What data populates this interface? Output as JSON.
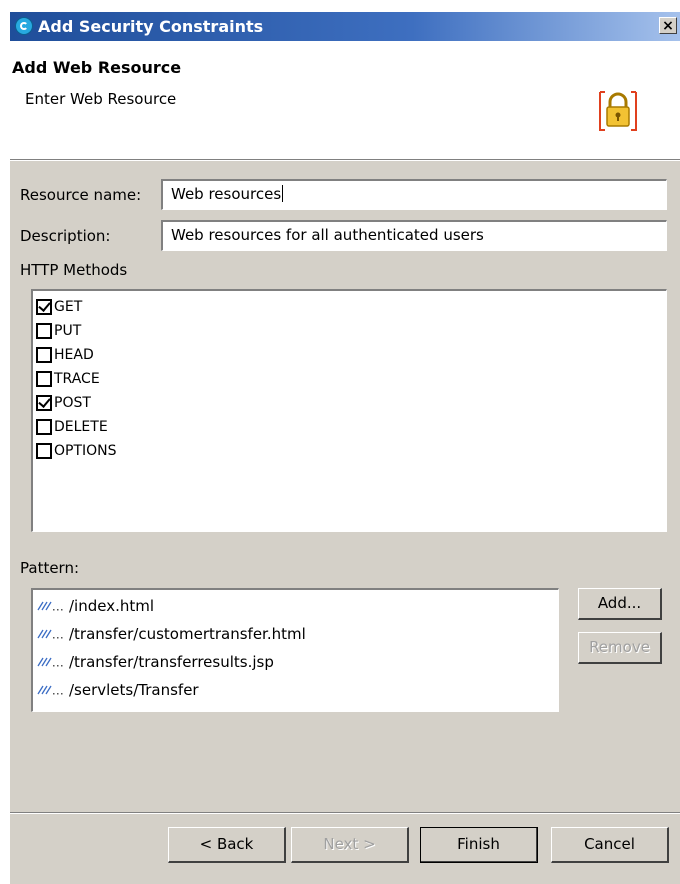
{
  "window": {
    "title": "Add Security Constraints",
    "close_label": "×"
  },
  "banner": {
    "title": "Add Web Resource",
    "description": "Enter Web Resource",
    "icon": "lock-icon"
  },
  "form": {
    "resource_name_label": "Resource name:",
    "resource_name_value": "Web resources",
    "description_label": "Description:",
    "description_value": "Web resources for all authenticated users",
    "http_methods_label": "HTTP Methods",
    "methods": [
      {
        "label": "GET",
        "checked": true
      },
      {
        "label": "PUT",
        "checked": false
      },
      {
        "label": "HEAD",
        "checked": false
      },
      {
        "label": "TRACE",
        "checked": false
      },
      {
        "label": "POST",
        "checked": true
      },
      {
        "label": "DELETE",
        "checked": false
      },
      {
        "label": "OPTIONS",
        "checked": false
      }
    ],
    "pattern_label": "Pattern:",
    "patterns": [
      "/index.html",
      "/transfer/customertransfer.html",
      "/transfer/transferresults.jsp",
      "/servlets/Transfer"
    ],
    "add_label": "Add...",
    "remove_label": "Remove"
  },
  "footer": {
    "back_label": "< Back",
    "next_label": "Next >",
    "finish_label": "Finish",
    "cancel_label": "Cancel"
  },
  "colors": {
    "dialog_bg": "#d4d0c8",
    "titlebar": "#1f4e9a",
    "disabled_text": "#a0a0a0"
  }
}
